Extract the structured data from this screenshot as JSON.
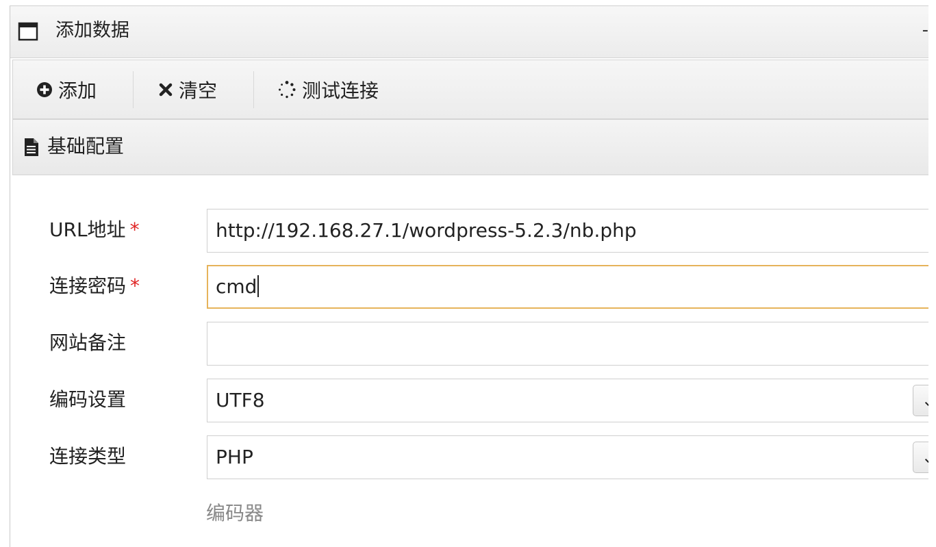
{
  "window": {
    "title": "添加数据",
    "title_right": "-"
  },
  "toolbar": {
    "add_label": "添加",
    "clear_label": "清空",
    "test_label": "测试连接"
  },
  "section": {
    "title": "基础配置"
  },
  "form": {
    "url": {
      "label": "URL地址",
      "required_mark": "*",
      "value": "http://192.168.27.1/wordpress-5.2.3/nb.php"
    },
    "password": {
      "label": "连接密码",
      "required_mark": "*",
      "value": "cmd"
    },
    "note": {
      "label": "网站备注",
      "value": ""
    },
    "encoding": {
      "label": "编码设置",
      "value": "UTF8"
    },
    "type": {
      "label": "连接类型",
      "value": "PHP"
    },
    "encoder_label": "编码器"
  },
  "colors": {
    "required": "#e02424",
    "focus_border": "#e6b35a"
  }
}
